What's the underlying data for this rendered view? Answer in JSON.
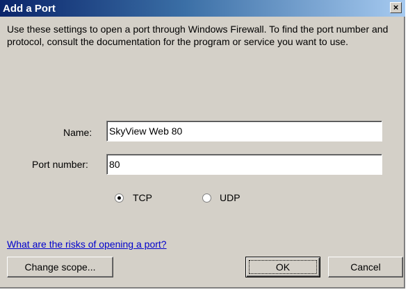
{
  "window": {
    "title": "Add a Port",
    "close_label": "×"
  },
  "description": "Use these settings to open a port through Windows Firewall. To find the port number and protocol, consult the documentation for the program or service you want to use.",
  "form": {
    "name_label": "Name:",
    "name_value": "SkyView Web 80",
    "port_label": "Port number:",
    "port_value": "80",
    "protocol": {
      "selected": "TCP",
      "tcp_label": "TCP",
      "udp_label": "UDP"
    }
  },
  "risk_link": "What are the risks of opening a port?",
  "buttons": {
    "change_scope": "Change scope...",
    "ok": "OK",
    "cancel": "Cancel"
  }
}
